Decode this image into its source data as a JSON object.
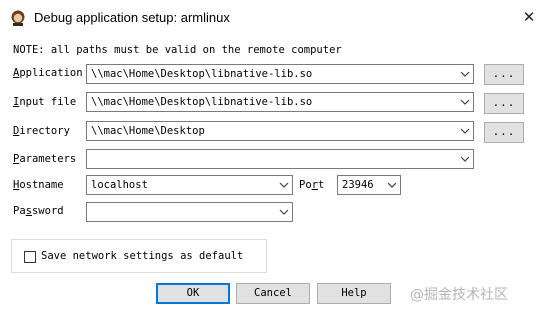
{
  "window": {
    "title": "Debug application setup: armlinux",
    "close_glyph": "✕"
  },
  "note": "NOTE: all paths must be valid on the remote computer",
  "fields": {
    "application": {
      "label_first": "A",
      "label_rest": "pplication",
      "value": "\\\\mac\\Home\\Desktop\\libnative-lib.so",
      "browse": "..."
    },
    "input_file": {
      "label_first": "I",
      "label_rest": "nput file",
      "value": "\\\\mac\\Home\\Desktop\\libnative-lib.so",
      "browse": "..."
    },
    "directory": {
      "label_first": "D",
      "label_rest": "irectory",
      "value": "\\\\mac\\Home\\Desktop",
      "browse": "..."
    },
    "parameters": {
      "label_first": "P",
      "label_rest": "arameters",
      "value": ""
    },
    "hostname": {
      "label_first": "H",
      "label_rest": "ostname",
      "value": "localhost"
    },
    "port": {
      "label_pre": "Po",
      "label_u": "r",
      "label_post": "t",
      "value": "23946"
    },
    "password": {
      "label_pre": "Pa",
      "label_u": "s",
      "label_post": "sword",
      "value": ""
    }
  },
  "save_settings": {
    "label": "Save network settings as default",
    "checked": false
  },
  "buttons": {
    "ok": "OK",
    "cancel": "Cancel",
    "help": "Help"
  },
  "watermark": "@掘金技术社区"
}
